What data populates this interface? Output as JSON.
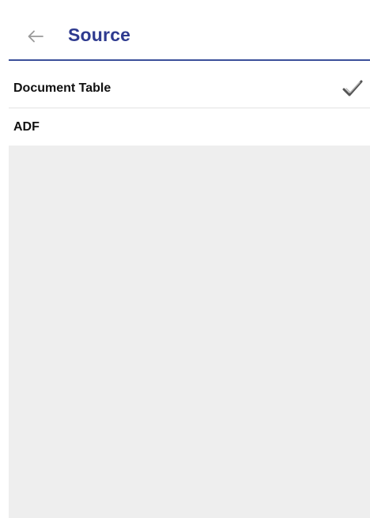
{
  "header": {
    "back_icon": "arrow-left-icon",
    "title": "Source"
  },
  "options": [
    {
      "label": "Document Table",
      "selected": true,
      "check_icon": "checkmark-icon"
    },
    {
      "label": "ADF",
      "selected": false
    }
  ],
  "colors": {
    "accent": "#2e3a8f",
    "divider": "#3b4f9a",
    "list_background": "#eeeeee"
  }
}
